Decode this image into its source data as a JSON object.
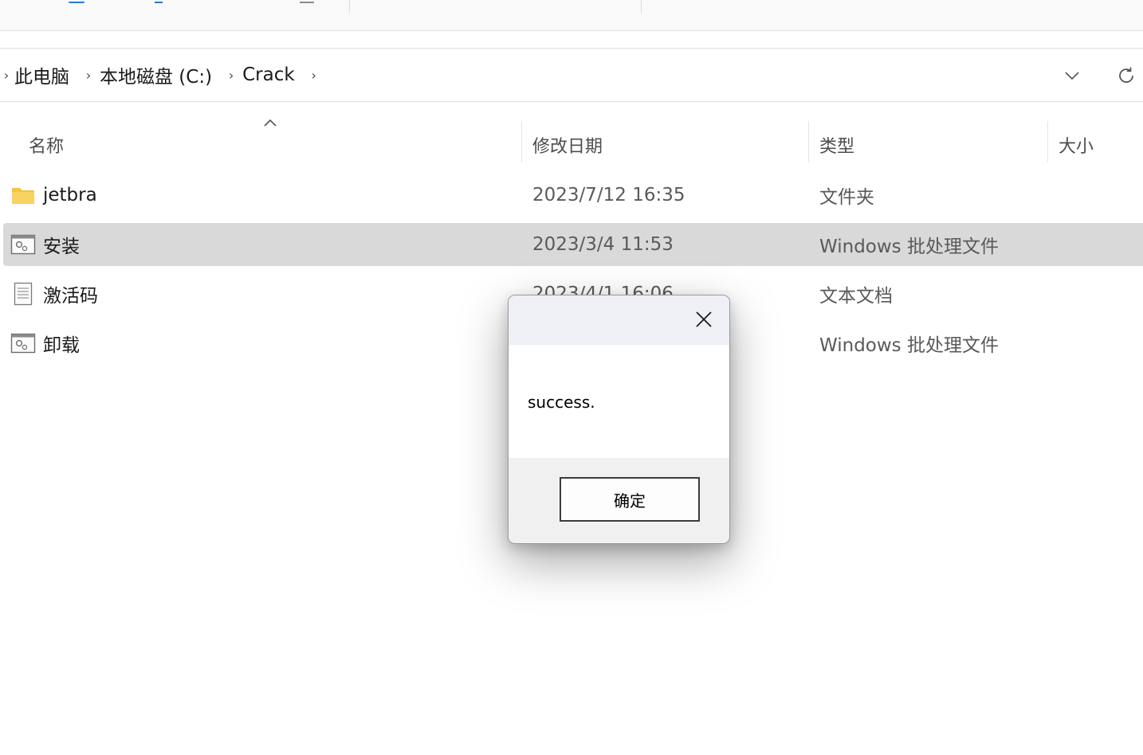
{
  "address_bar": {
    "breadcrumbs": [
      "此电脑",
      "本地磁盘 (C:)",
      "Crack"
    ],
    "separator": "›"
  },
  "columns": {
    "name": "名称",
    "date_modified": "修改日期",
    "type": "类型",
    "size": "大小",
    "sort_indicator": "ascending"
  },
  "files": [
    {
      "name": "jetbra",
      "date": "2023/7/12 16:35",
      "type": "文件夹",
      "icon": "folder-icon",
      "selected": false
    },
    {
      "name": "安装",
      "date": "2023/3/4 11:53",
      "type": "Windows 批处理文件",
      "icon": "batch-file-icon",
      "selected": true
    },
    {
      "name": "激活码",
      "date": "2023/4/1 16:06",
      "type": "文本文档",
      "icon": "text-file-icon",
      "selected": false
    },
    {
      "name": "卸载",
      "date": "",
      "type": "Windows 批处理文件",
      "icon": "batch-file-icon",
      "selected": false
    }
  ],
  "dialog": {
    "title": "",
    "message": "success.",
    "ok_label": "确定"
  },
  "colors": {
    "selection": "#d9d9d9",
    "folder": "#f5c342",
    "dialog_title_bg": "#eef0f5",
    "dialog_footer_bg": "#f0f0f0"
  }
}
